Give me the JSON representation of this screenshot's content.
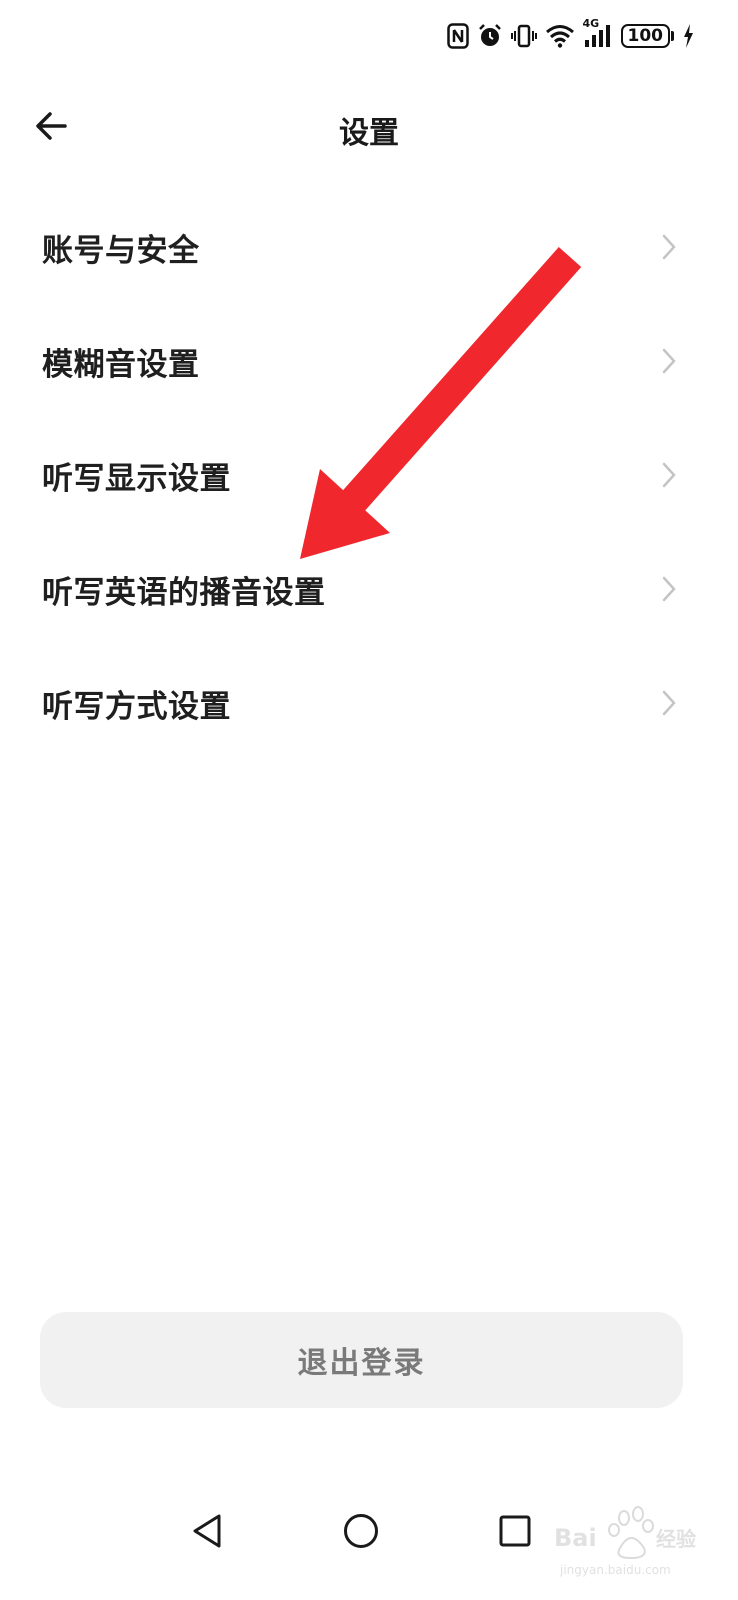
{
  "status_bar": {
    "icons": [
      "nfc-icon",
      "alarm-icon",
      "vibrate-icon",
      "wifi-icon",
      "signal-4g-icon",
      "battery-icon",
      "charging-icon"
    ],
    "network_type": "4G",
    "battery_level": "100"
  },
  "header": {
    "back_icon": "arrow-left-icon",
    "title": "设置"
  },
  "settings": {
    "items": [
      {
        "label": "账号与安全"
      },
      {
        "label": "模糊音设置"
      },
      {
        "label": "听写显示设置"
      },
      {
        "label": "听写英语的播音设置"
      },
      {
        "label": "听写方式设置"
      }
    ]
  },
  "annotation": {
    "type": "arrow",
    "color": "#f0282d",
    "points_to": "听写英语的播音设置"
  },
  "logout": {
    "label": "退出登录"
  },
  "nav_bar": {
    "icons": [
      "nav-back-triangle-icon",
      "nav-home-circle-icon",
      "nav-recent-square-icon"
    ]
  },
  "watermark": {
    "brand": "Baidu经验",
    "url": "jingyan.baidu.com"
  },
  "colors": {
    "background": "#ffffff",
    "text_primary": "#1f1f1f",
    "chevron": "#c4c4c4",
    "logout_bg": "#f1f1f1",
    "logout_text": "#7a7a7a",
    "annotation_red": "#f0282d"
  }
}
